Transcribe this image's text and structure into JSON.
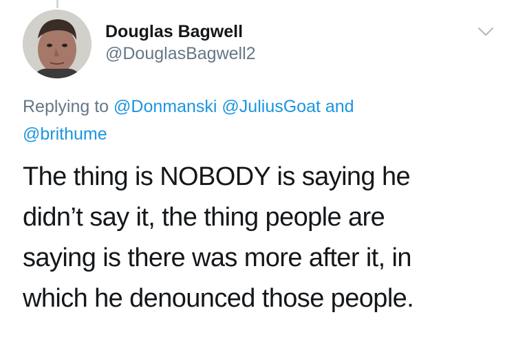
{
  "tweet": {
    "author": {
      "display_name": "Douglas Bagwell",
      "handle": "@DouglasBagwell2"
    },
    "reply_context": {
      "prefix": "Replying to",
      "mentions": [
        "@Donmanski",
        "@JuliusGoat",
        "@brithume"
      ],
      "conjunction": "and"
    },
    "text_lines": [
      "The thing is NOBODY is saying he",
      "didn’t say it, the thing people are",
      "saying is there was more after it, in",
      "which he denounced those people."
    ]
  },
  "icons": {
    "avatar": "profile-photo",
    "caret": "chevron-down-icon"
  },
  "colors": {
    "text": "#14171a",
    "secondary": "#657786",
    "link": "#1b95e0"
  }
}
